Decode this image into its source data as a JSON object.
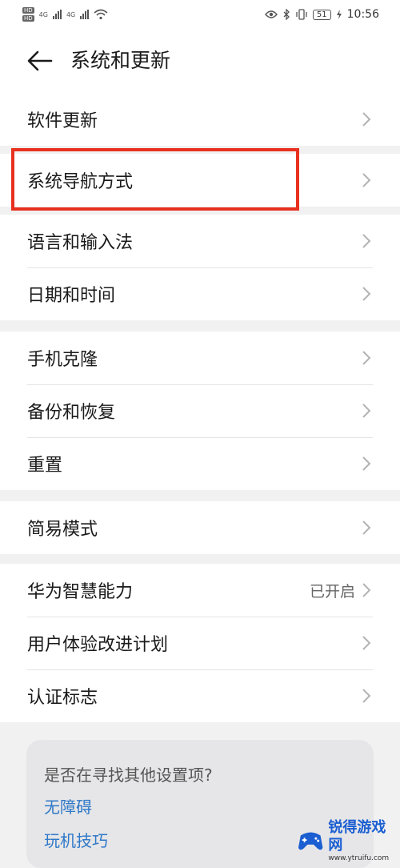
{
  "statusbar": {
    "hd_top": "HD",
    "hd_bottom": "HD",
    "net1": "4G",
    "net2": "4G",
    "battery": "51",
    "time": "10:56"
  },
  "header": {
    "title": "系统和更新"
  },
  "groups": [
    {
      "items": [
        {
          "label": "软件更新"
        }
      ]
    },
    {
      "items": [
        {
          "label": "系统导航方式"
        }
      ]
    },
    {
      "items": [
        {
          "label": "语言和输入法"
        },
        {
          "label": "日期和时间"
        }
      ]
    },
    {
      "items": [
        {
          "label": "手机克隆"
        },
        {
          "label": "备份和恢复"
        },
        {
          "label": "重置"
        }
      ]
    },
    {
      "items": [
        {
          "label": "简易模式"
        }
      ]
    },
    {
      "items": [
        {
          "label": "华为智慧能力",
          "value": "已开启"
        },
        {
          "label": "用户体验改进计划"
        },
        {
          "label": "认证标志"
        }
      ]
    }
  ],
  "suggestions": {
    "title": "是否在寻找其他设置项?",
    "links": [
      "无障碍",
      "玩机技巧"
    ]
  },
  "watermark": {
    "title": "锐得游戏网",
    "url": "www.ytruifu.com"
  },
  "colors": {
    "highlight": "#e8301f",
    "link": "#2f78c8",
    "background": "#f1f1f1"
  }
}
